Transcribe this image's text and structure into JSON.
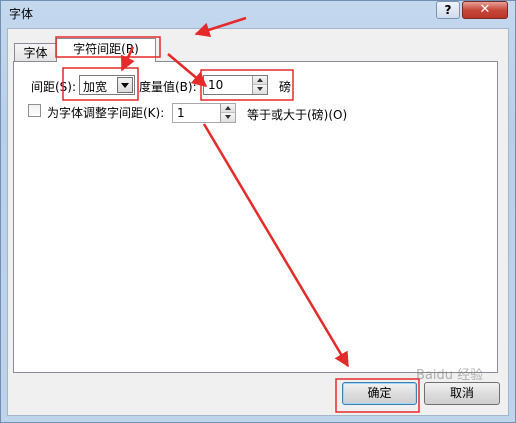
{
  "window": {
    "title": "字体",
    "help_label": "?",
    "close_label": "✕"
  },
  "tabs": [
    {
      "label": "字体(N)"
    },
    {
      "label": "字符间距(R)"
    }
  ],
  "spacing": {
    "label": "间距(S):",
    "selected": "加宽",
    "measure_label": "度量值(B):",
    "measure_value": "10",
    "unit_label": "磅"
  },
  "kerning": {
    "checkbox_label": "为字体调整字间距(K):",
    "value": "1",
    "suffix_label": "等于或大于(磅)(O)"
  },
  "buttons": {
    "ok_label": "确定",
    "cancel_label": "取消"
  },
  "watermark": "Baidu 经验",
  "colors": {
    "annotation_red": "#e52a2a"
  }
}
